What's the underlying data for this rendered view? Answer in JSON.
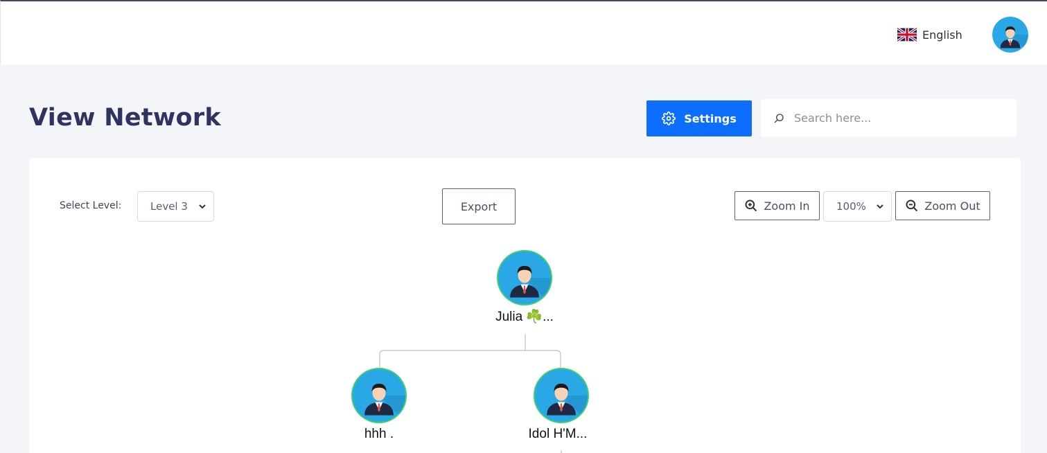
{
  "header": {
    "language_label": "English",
    "language_flag_icon": "uk-flag-icon",
    "avatar_icon": "user-avatar-icon"
  },
  "page": {
    "title": "View Network"
  },
  "toolbar": {
    "settings_label": "Settings",
    "settings_icon": "gear-icon",
    "search_placeholder": "Search here...",
    "search_icon": "search-icon"
  },
  "controls": {
    "select_level_label": "Select Level:",
    "level_value": "Level 3",
    "export_label": "Export",
    "zoom_in_label": "Zoom In",
    "zoom_value": "100%",
    "zoom_out_label": "Zoom Out"
  },
  "tree": {
    "root": {
      "label": "Julia ☘️..."
    },
    "children": [
      {
        "label": "hhh ."
      },
      {
        "label": "Idol H'M..."
      }
    ]
  },
  "colors": {
    "primary": "#0d6efd",
    "title": "#2f3360",
    "node_border": "#3ecf6e",
    "avatar_bg": "#2aa8e6"
  }
}
